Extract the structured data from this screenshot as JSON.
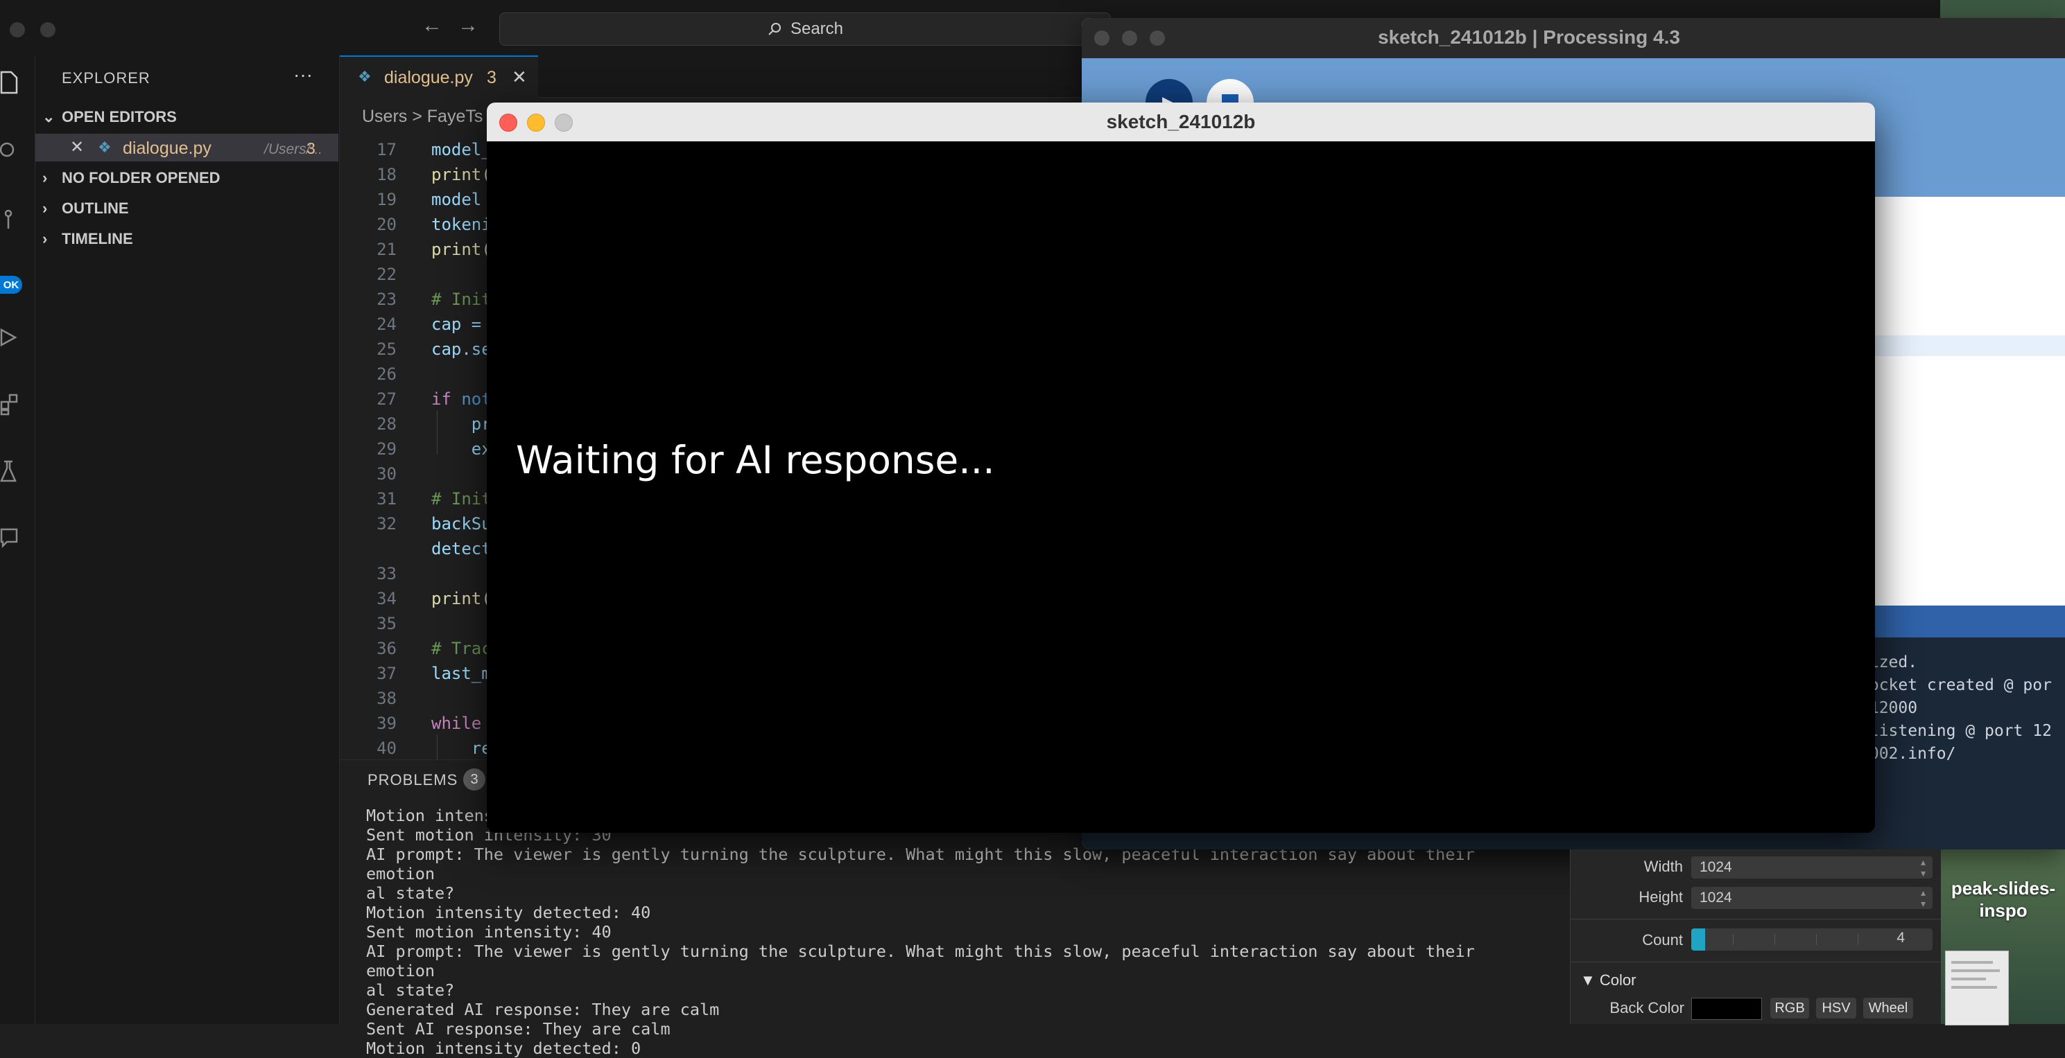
{
  "vscode": {
    "search_placeholder": "Search",
    "badge": "OK",
    "explorer": {
      "title": "EXPLORER",
      "more": "···",
      "sections": [
        "OPEN EDITORS",
        "NO FOLDER OPENED",
        "OUTLINE",
        "TIMELINE"
      ],
      "open_editor": {
        "name": "dialogue.py",
        "path": "/Users/...",
        "count": "3"
      }
    },
    "tab": {
      "label": "dialogue.py",
      "count": "3"
    },
    "breadcrumb": "Users > FayeTs",
    "code_lines": [
      {
        "n": "17",
        "text": "model_"
      },
      {
        "n": "18",
        "text": "print("
      },
      {
        "n": "19",
        "text": "model "
      },
      {
        "n": "20",
        "text": "tokeni"
      },
      {
        "n": "21",
        "text": "print("
      },
      {
        "n": "22",
        "text": ""
      },
      {
        "n": "23",
        "text": "# Init"
      },
      {
        "n": "24",
        "text": "cap = "
      },
      {
        "n": "25",
        "text": "cap.se"
      },
      {
        "n": "26",
        "text": ""
      },
      {
        "n": "27",
        "text": "if not"
      },
      {
        "n": "28",
        "text": "    pr"
      },
      {
        "n": "29",
        "text": "    ex"
      },
      {
        "n": "30",
        "text": ""
      },
      {
        "n": "31",
        "text": "# Init"
      },
      {
        "n": "32",
        "text": "backSu"
      },
      {
        "n": "",
        "text": "detect"
      },
      {
        "n": "33",
        "text": ""
      },
      {
        "n": "34",
        "text": "print("
      },
      {
        "n": "35",
        "text": ""
      },
      {
        "n": "36",
        "text": "# Trac"
      },
      {
        "n": "37",
        "text": "last_m"
      },
      {
        "n": "38",
        "text": ""
      },
      {
        "n": "39",
        "text": "while "
      },
      {
        "n": "40",
        "text": "    re"
      }
    ],
    "panel": {
      "tab": "PROBLEMS",
      "count": "3",
      "output": "Motion intensity detected: 30\nSent motion intensity: 30\nAI prompt: The viewer is gently turning the sculpture. What might this slow, peaceful interaction say about their emotion\nal state?\nMotion intensity detected: 40\nSent motion intensity: 40\nAI prompt: The viewer is gently turning the sculpture. What might this slow, peaceful interaction say about their emotion\nal state?\nGenerated AI response: They are calm\nSent AI response: They are calm\nMotion intensity detected: 0"
    }
  },
  "processing": {
    "title": "sketch_241012b | Processing 4.3",
    "console": "lized.\nSocket created @ por\n 12000\n listening @ port 12\n/002.info/"
  },
  "sketch": {
    "title": "sketch_241012b",
    "message": "Waiting for AI response..."
  },
  "tweak": {
    "width_label": "Width",
    "width_value": "1024",
    "height_label": "Height",
    "height_value": "1024",
    "count_label": "Count",
    "count_value": "4",
    "count_fraction": 0.04,
    "color_section": "Color",
    "back_color_label": "Back Color",
    "back_color_value": "#000000",
    "buttons": [
      "RGB",
      "HSV",
      "Wheel"
    ]
  },
  "desktop": {
    "label": "peak-slides-\ninspo"
  },
  "colors": {
    "accent": "#0078d4",
    "processing_blue": "#6a9bd1",
    "close_red": "#ff5f57",
    "minimize_yellow": "#febc2e",
    "zoom_gray": "#c8c8c8"
  }
}
